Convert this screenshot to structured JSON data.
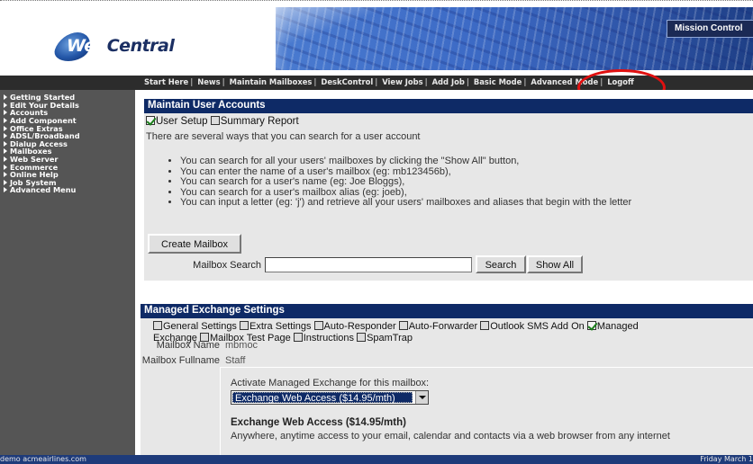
{
  "header": {
    "logo_web": "Web",
    "logo_central": "Central",
    "mission_control": "Mission Control"
  },
  "nav": {
    "items": [
      "Start Here",
      "News",
      "Maintain Mailboxes",
      "DeskControl",
      "View Jobs",
      "Add Job",
      "Basic Mode",
      "Advanced Mode",
      "Logoff"
    ],
    "separator": "|"
  },
  "sidebar": {
    "items": [
      "Getting Started",
      "Edit Your Details",
      "Accounts",
      "Add Component",
      "Office Extras",
      "ADSL/Broadband",
      "Dialup Access",
      "Mailboxes",
      "Web Server",
      "Ecommerce",
      "Online Help",
      "Job System",
      "Advanced Menu"
    ]
  },
  "maintain": {
    "title": "Maintain User Accounts",
    "tab_user_setup": "User Setup",
    "tab_summary_report": "Summary Report",
    "intro": "There are several ways that you can search for a user account",
    "bullets": [
      "You can search for all your users' mailboxes by clicking the \"Show All\" button,",
      "You can enter the name of a user's mailbox (eg: mb123456b),",
      "You can search for a user's name (eg: Joe Bloggs),",
      "You can search for a user's mailbox alias (eg: joeb),",
      "You can input a letter (eg: 'j') and retrieve all your users' mailboxes and aliases that begin with the letter"
    ],
    "create_mailbox": "Create Mailbox",
    "search_label": "Mailbox Search",
    "search_value": "",
    "search_button": "Search",
    "show_all_button": "Show All"
  },
  "exchange": {
    "title": "Managed Exchange Settings",
    "tabs": [
      "General Settings",
      "Extra Settings",
      "Auto-Responder",
      "Auto-Forwarder",
      "Outlook SMS Add On",
      "Managed Exchange",
      "Mailbox Test Page",
      "Instructions",
      "SpamTrap"
    ],
    "mailbox_name_label": "Mailbox Name",
    "mailbox_name": "mbmoc",
    "fullname_label": "Mailbox Fullname",
    "fullname": "Staff",
    "activate_label": "Activate Managed Exchange for this mailbox:",
    "selected_option": "Exchange Web Access ($14.95/mth)",
    "ewa_title": "Exchange Web Access ($14.95/mth)",
    "ewa_desc": "Anywhere, anytime access to your email, calendar and contacts via a web browser from any internet"
  },
  "footer": {
    "left": "demo  acmeairlines.com",
    "right": "Friday March 1"
  },
  "colors": {
    "title_bar": "#0e2a66",
    "sidebar": "#555555",
    "navbar": "#2c2c2c",
    "footer": "#1e3b7a",
    "highlight": "#e01010",
    "panel": "#e7e7e7"
  }
}
